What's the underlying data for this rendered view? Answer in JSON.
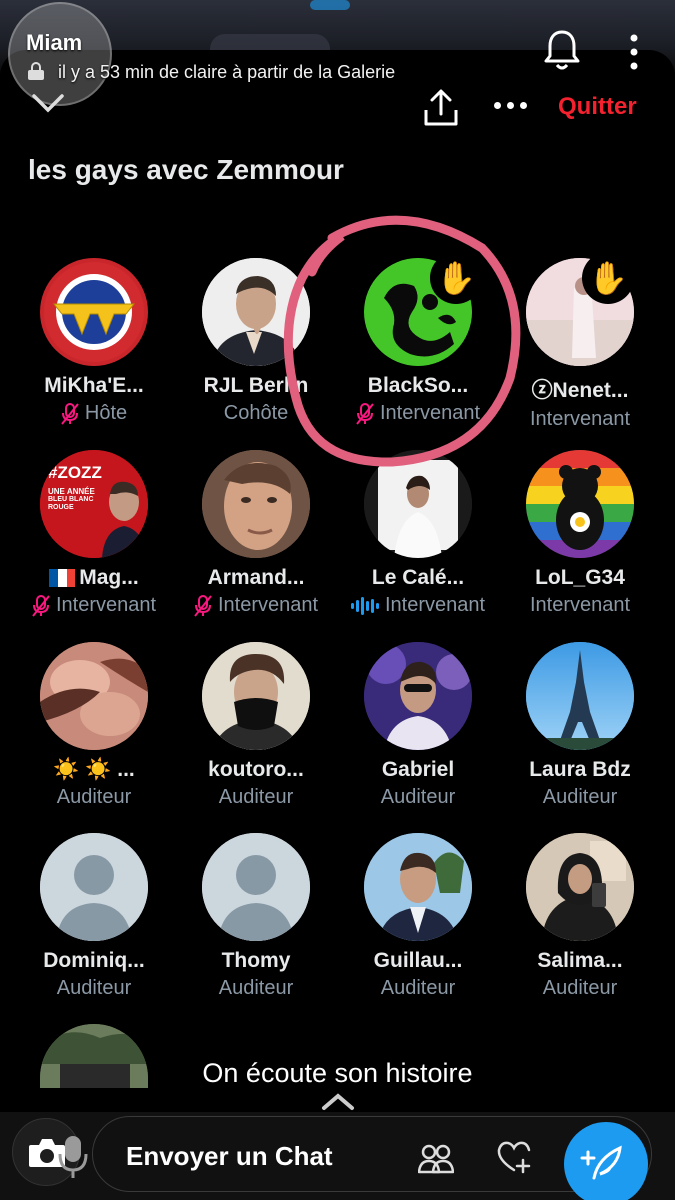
{
  "story": {
    "author": "Miam",
    "subtitle": "il y a 53 min de claire à partir de la Galerie"
  },
  "space": {
    "title": "les gays avec Zemmour",
    "quit_label": "Quitter"
  },
  "participants": [
    {
      "name": "MiKha'E...",
      "role": "Hôte",
      "muted": true
    },
    {
      "name": "RJL Berlin",
      "role": "Cohôte",
      "muted": false
    },
    {
      "name": "BlackSo...",
      "role": "Intervenant",
      "muted": true,
      "hand_raised": true
    },
    {
      "name": "ⓩNenet...",
      "role": "Intervenant",
      "muted": true,
      "hand_raised": true
    },
    {
      "name": "Mag...",
      "role": "Intervenant",
      "muted": true,
      "flag": "fr"
    },
    {
      "name": "Armand...",
      "role": "Intervenant",
      "muted": true
    },
    {
      "name": "Le Calé...",
      "role": "Intervenant",
      "speaking": true
    },
    {
      "name": "LoL_G34",
      "role": "Intervenant"
    },
    {
      "name": "☀️ ☀️ ...",
      "role": "Auditeur"
    },
    {
      "name": "koutoro...",
      "role": "Auditeur"
    },
    {
      "name": "Gabriel",
      "role": "Auditeur"
    },
    {
      "name": "Laura Bdz",
      "role": "Auditeur"
    },
    {
      "name": "Dominiq...",
      "role": "Auditeur"
    },
    {
      "name": "Thomy",
      "role": "Auditeur"
    },
    {
      "name": "Guillau...",
      "role": "Auditeur"
    },
    {
      "name": "Salima...",
      "role": "Auditeur"
    }
  ],
  "avatar_31_badge": {
    "line1": "#ZOZZ",
    "line2": "UNE ANNÉE",
    "line3": "BLEU BLANC ROUGE"
  },
  "caption": "On écoute son histoire",
  "bottom": {
    "chat_label": "Envoyer un Chat"
  },
  "colors": {
    "accent_blue": "#1d9bf0",
    "quit_red": "#f4212e",
    "muted_pink": "#f91880",
    "annotation_pink": "#e0607e",
    "secondary_text": "#8b98a5"
  }
}
